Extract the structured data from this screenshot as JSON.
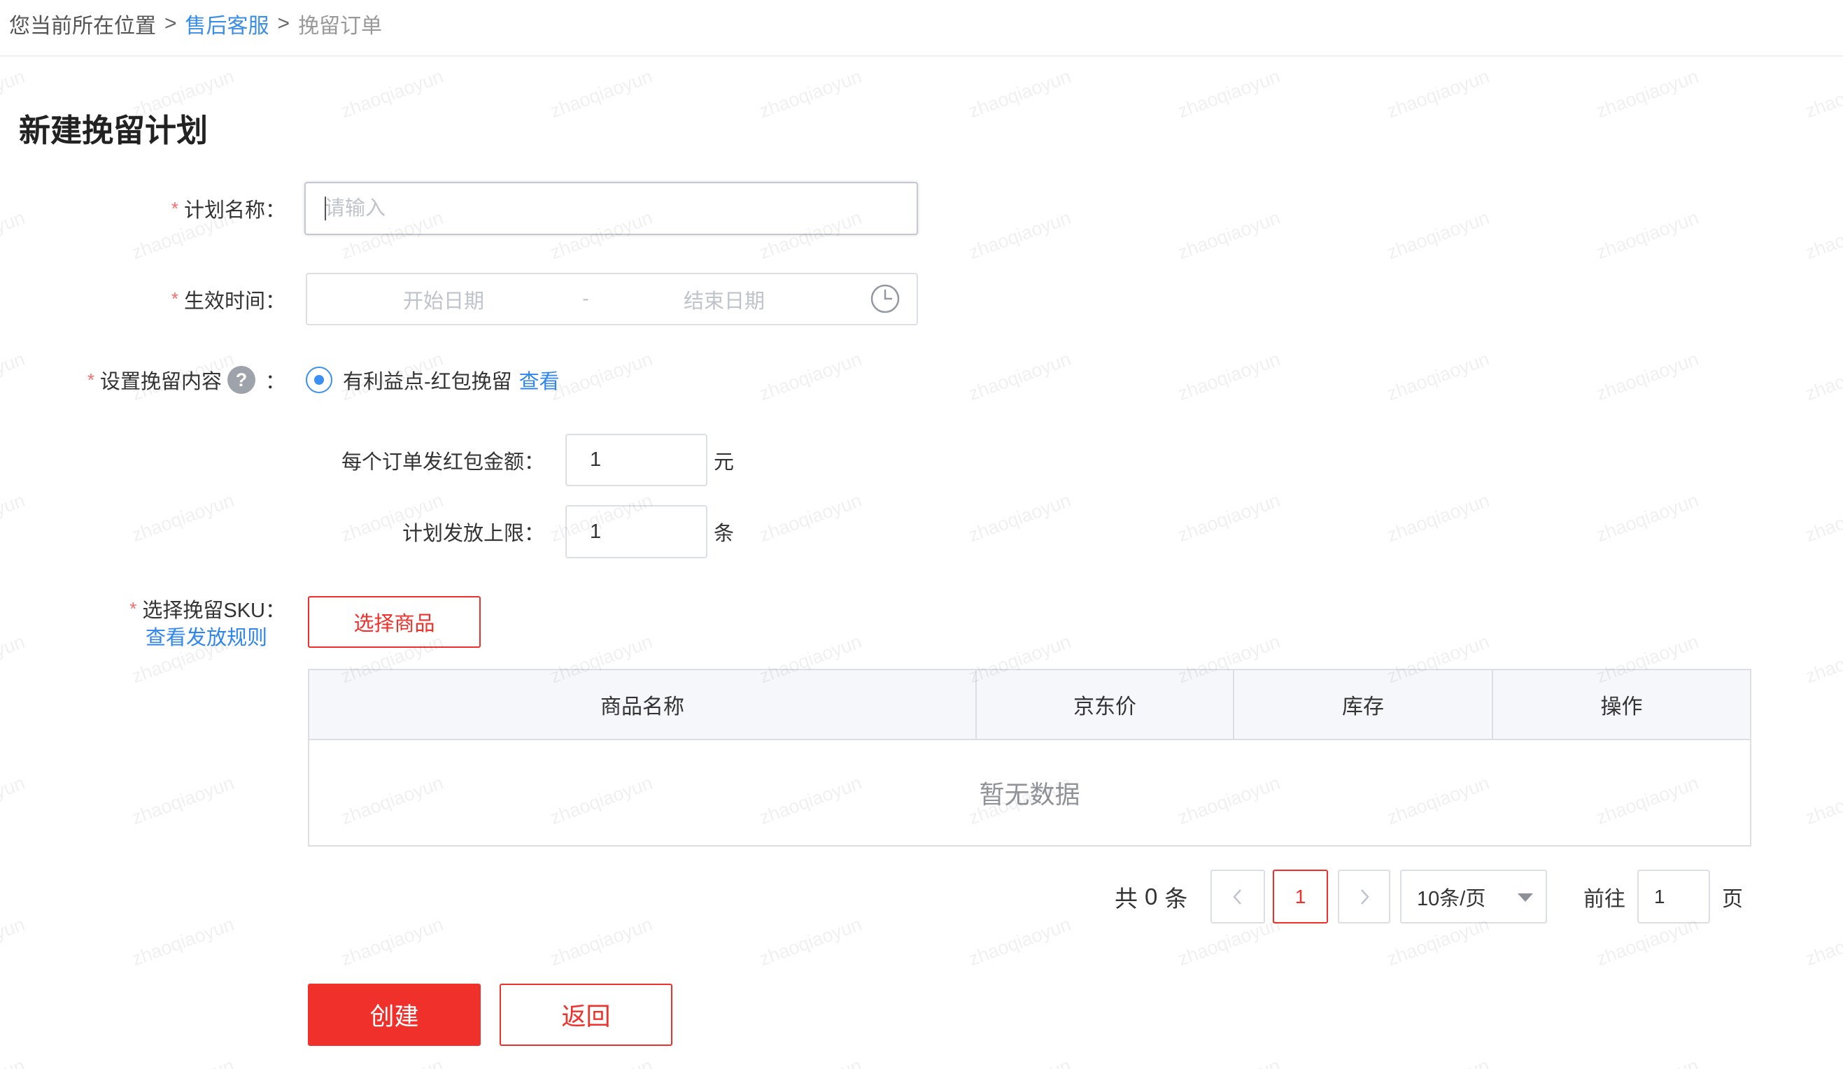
{
  "breadcrumb": {
    "prefix": "您当前所在位置",
    "separator": ">",
    "link": "售后客服",
    "current": "挽留订单"
  },
  "page_title": "新建挽留计划",
  "form": {
    "required_mark": "*",
    "plan_name": {
      "label": "计划名称：",
      "placeholder": "请输入",
      "value": ""
    },
    "effective_time": {
      "label": "生效时间：",
      "start_placeholder": "开始日期",
      "range_separator": "-",
      "end_placeholder": "结束日期",
      "icon": "clock-icon"
    },
    "retention_content": {
      "label": "设置挽留内容",
      "help_icon": "?",
      "colon": "：",
      "option_label": "有利益点-红包挽留",
      "option_selected": true,
      "view_link": "查看"
    },
    "red_packet_amount": {
      "label": "每个订单发红包金额：",
      "value": "1",
      "unit": "元"
    },
    "issue_limit": {
      "label": "计划发放上限：",
      "value": "1",
      "unit": "条"
    },
    "sku": {
      "label": "选择挽留SKU：",
      "rule_link": "查看发放规则",
      "select_button": "选择商品"
    }
  },
  "table": {
    "columns": [
      "商品名称",
      "京东价",
      "库存",
      "操作"
    ],
    "rows": [],
    "empty_text": "暂无数据"
  },
  "pagination": {
    "total_prefix": "共",
    "total": "0",
    "total_suffix": "条",
    "prev_icon": "chevron-left-icon",
    "current_page": "1",
    "next_icon": "chevron-right-icon",
    "page_size": "10条/页",
    "page_size_icon": "caret-down-icon",
    "goto_label": "前往",
    "goto_value": "1",
    "goto_suffix": "页"
  },
  "actions": {
    "create": "创建",
    "back": "返回"
  },
  "colors": {
    "primary_red": "#f0312b",
    "link_blue": "#2f86f0",
    "required_red": "#f56c6c",
    "radio_blue": "#3b8ff2"
  },
  "watermark": "zhaoqiaoyun"
}
